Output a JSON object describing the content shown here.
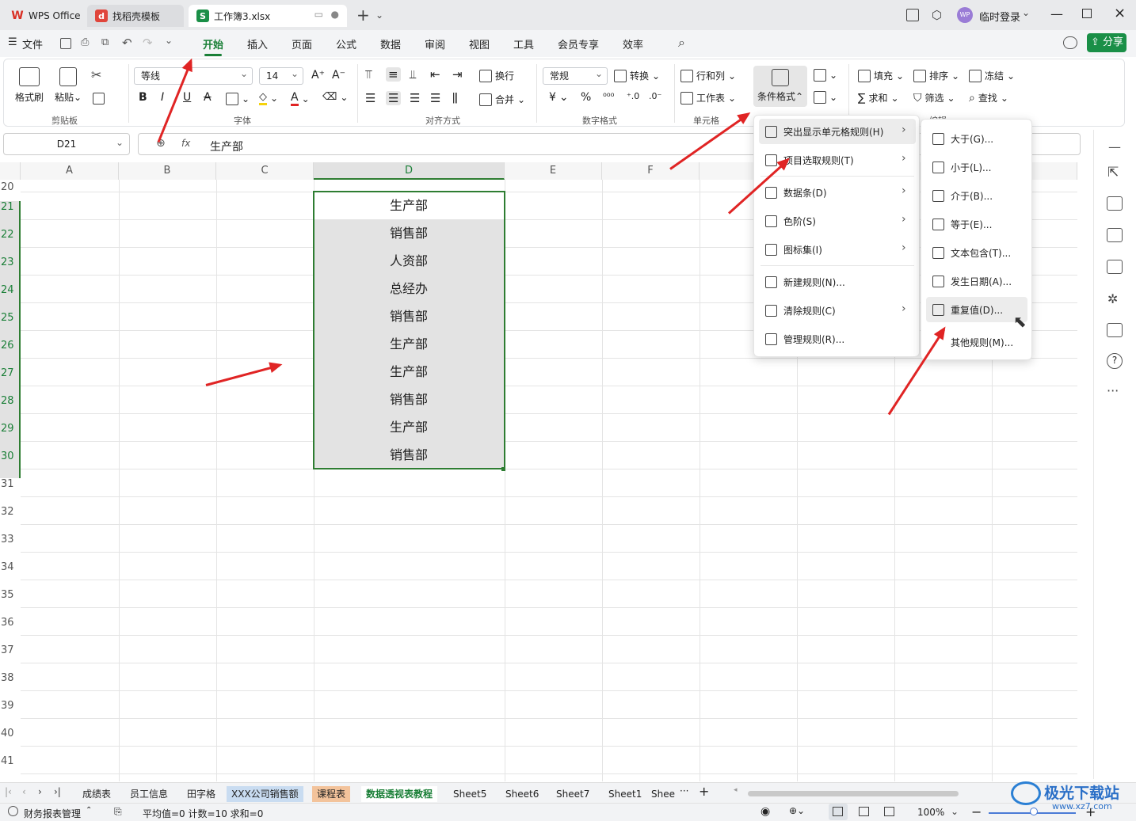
{
  "titlebar": {
    "tabs": [
      {
        "label": "WPS Office",
        "color": "#d93025"
      },
      {
        "label": "找稻壳模板",
        "color": "#e0453b"
      },
      {
        "label": "工作簿3.xlsx",
        "color": "#1a8f47",
        "logo": "S"
      }
    ],
    "new_tab": "+",
    "user": "临时登录",
    "avatar": "WP"
  },
  "menubar": {
    "file": "文件",
    "tabs": [
      "开始",
      "插入",
      "页面",
      "公式",
      "数据",
      "审阅",
      "视图",
      "工具",
      "会员专享",
      "效率"
    ],
    "active_tab": "开始",
    "share": "分享"
  },
  "ribbon": {
    "clipboard": {
      "format_painter": "格式刷",
      "paste": "粘贴",
      "label": "剪贴板"
    },
    "font": {
      "name": "等线",
      "size": "14",
      "label": "字体",
      "bold": "B",
      "italic": "I",
      "underline": "U"
    },
    "align": {
      "wrap": "换行",
      "merge": "合并",
      "label": "对齐方式"
    },
    "number": {
      "format": "常规",
      "convert": "转换",
      "label": "数字格式",
      "currency": "¥",
      "percent": "%"
    },
    "cells": {
      "rows_cols": "行和列",
      "sheet": "工作表",
      "cond_format": "条件格式",
      "label": "单元格"
    },
    "edit": {
      "fill": "填充",
      "sort": "排序",
      "freeze": "冻结",
      "sum": "求和",
      "filter": "筛选",
      "find": "查找",
      "label": "编辑"
    }
  },
  "formula_bar": {
    "name_box": "D21",
    "fx": "fx",
    "value": "生产部"
  },
  "columns": [
    "A",
    "B",
    "C",
    "D",
    "E",
    "F"
  ],
  "rows": [
    "20",
    "21",
    "22",
    "23",
    "24",
    "25",
    "26",
    "27",
    "28",
    "29",
    "30",
    "31",
    "32",
    "33",
    "34",
    "35",
    "36",
    "37",
    "38",
    "39",
    "40",
    "41"
  ],
  "column_d_values": [
    "生产部",
    "销售部",
    "人资部",
    "总经办",
    "销售部",
    "生产部",
    "生产部",
    "销售部",
    "生产部",
    "销售部"
  ],
  "cond_menu": {
    "items": [
      "突出显示单元格规则(H)",
      "项目选取规则(T)",
      "数据条(D)",
      "色阶(S)",
      "图标集(I)",
      "新建规则(N)...",
      "清除规则(C)",
      "管理规则(R)..."
    ]
  },
  "submenu": {
    "items": [
      "大于(G)...",
      "小于(L)...",
      "介于(B)...",
      "等于(E)...",
      "文本包含(T)...",
      "发生日期(A)...",
      "重复值(D)...",
      "其他规则(M)..."
    ]
  },
  "sheet_tabs": [
    "成绩表",
    "员工信息",
    "田字格",
    "XXX公司销售额",
    "课程表",
    "数据透视表教程",
    "Sheet5",
    "Sheet6",
    "Sheet7",
    "Sheet1",
    "Shee"
  ],
  "active_sheet": "数据透视表教程",
  "statusbar": {
    "workbook_tool": "财务报表管理",
    "stats": "平均值=0  计数=10  求和=0",
    "zoom": "100%"
  },
  "watermark": {
    "text": "极光下载站",
    "url": "www.xz7.com"
  },
  "colors": {
    "accent": "#1a7f37",
    "arrow": "#e02424",
    "selection": "#e3e3e3"
  }
}
